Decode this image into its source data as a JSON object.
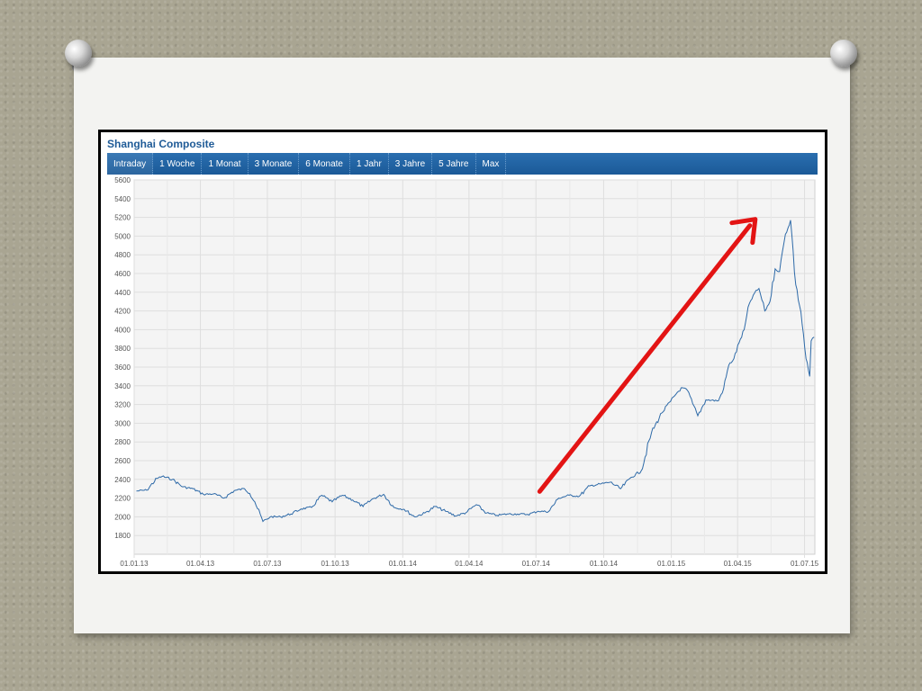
{
  "title": "Shanghai Composite",
  "tabs": [
    "Intraday",
    "1 Woche",
    "1 Monat",
    "3 Monate",
    "6 Monate",
    "1 Jahr",
    "3 Jahre",
    "5 Jahre",
    "Max"
  ],
  "colors": {
    "tab_bar": "#1b5a98",
    "line": "#2e6aa8",
    "arrow": "#e31414",
    "title": "#1f5b97"
  },
  "chart_data": {
    "type": "line",
    "title": "Shanghai Composite",
    "xlabel": "",
    "ylabel": "",
    "x_ticks": [
      "01.01.13",
      "01.04.13",
      "01.07.13",
      "01.10.13",
      "01.01.14",
      "01.04.14",
      "01.07.14",
      "01.10.14",
      "01.01.15",
      "01.04.15",
      "01.07.15"
    ],
    "y_ticks": [
      1800,
      2000,
      2200,
      2400,
      2600,
      2800,
      3000,
      3200,
      3400,
      3600,
      3800,
      4000,
      4200,
      4400,
      4600,
      4800,
      5000,
      5200,
      5400,
      5600
    ],
    "ylim": [
      1600,
      5600
    ],
    "xlim": [
      "2013-01-01",
      "2015-07-15"
    ],
    "grid": true,
    "series": [
      {
        "values": [
          [
            "2013-01-04",
            2276
          ],
          [
            "2013-01-18",
            2285
          ],
          [
            "2013-02-01",
            2410
          ],
          [
            "2013-02-08",
            2432
          ],
          [
            "2013-02-22",
            2400
          ],
          [
            "2013-03-08",
            2320
          ],
          [
            "2013-03-22",
            2300
          ],
          [
            "2013-04-05",
            2240
          ],
          [
            "2013-04-19",
            2245
          ],
          [
            "2013-05-03",
            2200
          ],
          [
            "2013-05-17",
            2280
          ],
          [
            "2013-05-31",
            2300
          ],
          [
            "2013-06-07",
            2250
          ],
          [
            "2013-06-14",
            2160
          ],
          [
            "2013-06-25",
            1950
          ],
          [
            "2013-07-05",
            2000
          ],
          [
            "2013-07-19",
            2000
          ],
          [
            "2013-08-02",
            2030
          ],
          [
            "2013-08-16",
            2085
          ],
          [
            "2013-08-30",
            2100
          ],
          [
            "2013-09-13",
            2230
          ],
          [
            "2013-09-27",
            2160
          ],
          [
            "2013-10-11",
            2230
          ],
          [
            "2013-10-25",
            2180
          ],
          [
            "2013-11-08",
            2110
          ],
          [
            "2013-11-22",
            2195
          ],
          [
            "2013-12-06",
            2240
          ],
          [
            "2013-12-20",
            2100
          ],
          [
            "2014-01-03",
            2080
          ],
          [
            "2014-01-17",
            2000
          ],
          [
            "2014-01-31",
            2040
          ],
          [
            "2014-02-14",
            2110
          ],
          [
            "2014-02-28",
            2060
          ],
          [
            "2014-03-14",
            2010
          ],
          [
            "2014-03-28",
            2045
          ],
          [
            "2014-04-11",
            2130
          ],
          [
            "2014-04-25",
            2040
          ],
          [
            "2014-05-09",
            2015
          ],
          [
            "2014-05-23",
            2030
          ],
          [
            "2014-06-06",
            2030
          ],
          [
            "2014-06-20",
            2025
          ],
          [
            "2014-07-04",
            2060
          ],
          [
            "2014-07-18",
            2055
          ],
          [
            "2014-08-01",
            2200
          ],
          [
            "2014-08-15",
            2230
          ],
          [
            "2014-08-29",
            2220
          ],
          [
            "2014-09-12",
            2330
          ],
          [
            "2014-09-26",
            2350
          ],
          [
            "2014-10-10",
            2370
          ],
          [
            "2014-10-24",
            2300
          ],
          [
            "2014-11-07",
            2420
          ],
          [
            "2014-11-21",
            2490
          ],
          [
            "2014-12-05",
            2900
          ],
          [
            "2014-12-19",
            3110
          ],
          [
            "2014-12-31",
            3235
          ],
          [
            "2015-01-09",
            3330
          ],
          [
            "2015-01-16",
            3380
          ],
          [
            "2015-01-23",
            3350
          ],
          [
            "2015-01-30",
            3210
          ],
          [
            "2015-02-06",
            3080
          ],
          [
            "2015-02-17",
            3250
          ],
          [
            "2015-03-06",
            3240
          ],
          [
            "2015-03-13",
            3370
          ],
          [
            "2015-03-20",
            3620
          ],
          [
            "2015-03-27",
            3690
          ],
          [
            "2015-04-03",
            3860
          ],
          [
            "2015-04-10",
            4000
          ],
          [
            "2015-04-17",
            4280
          ],
          [
            "2015-04-24",
            4390
          ],
          [
            "2015-04-30",
            4440
          ],
          [
            "2015-05-08",
            4200
          ],
          [
            "2015-05-15",
            4300
          ],
          [
            "2015-05-22",
            4650
          ],
          [
            "2015-05-28",
            4620
          ],
          [
            "2015-06-05",
            5020
          ],
          [
            "2015-06-12",
            5170
          ],
          [
            "2015-06-19",
            4480
          ],
          [
            "2015-06-26",
            4190
          ],
          [
            "2015-07-03",
            3690
          ],
          [
            "2015-07-08",
            3500
          ],
          [
            "2015-07-10",
            3880
          ],
          [
            "2015-07-14",
            3920
          ]
        ]
      }
    ]
  }
}
